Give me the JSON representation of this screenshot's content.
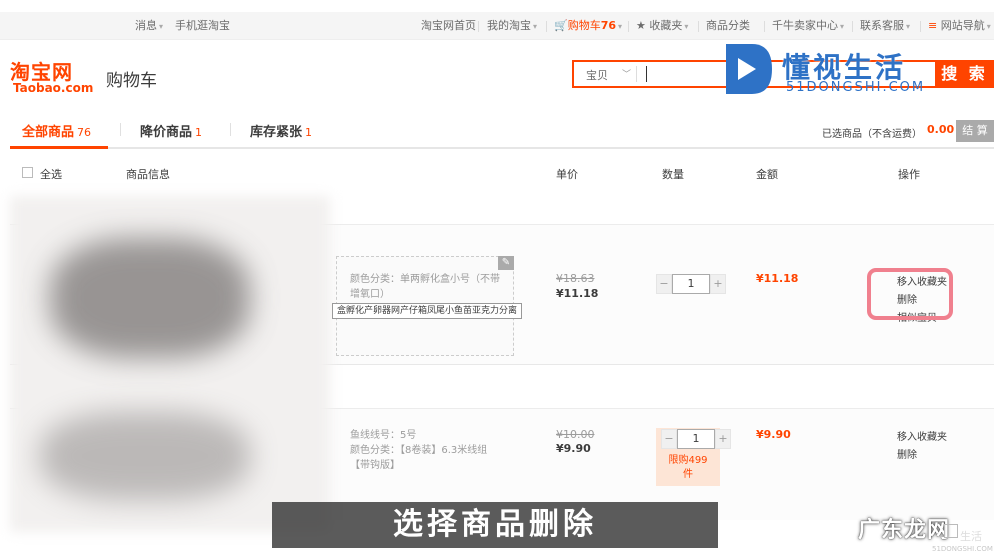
{
  "topbar": {
    "messages": "消息",
    "mobile": "手机逛淘宝",
    "home": "淘宝网首页",
    "my_taobao": "我的淘宝",
    "cart_label": "购物车",
    "cart_count": "76",
    "favorites": "收藏夹",
    "categories": "商品分类",
    "seller_center": "千牛卖家中心",
    "service": "联系客服",
    "site_nav": "网站导航"
  },
  "header": {
    "logo_cn": "淘宝网",
    "logo_en": "Taobao.com",
    "page_title": "购物车",
    "search_category": "宝贝",
    "search_button": "搜 索"
  },
  "watermark": {
    "name": "懂视生活",
    "domain": "51DONGSHI.COM"
  },
  "tabs": [
    {
      "label": "全部商品",
      "count": "76"
    },
    {
      "label": "降价商品",
      "count": "1"
    },
    {
      "label": "库存紧张",
      "count": "1"
    }
  ],
  "summary": {
    "selected_label": "已选商品（不含运费）",
    "selected_amount": "0.00",
    "settle_button": "结 算"
  },
  "columns": {
    "select_all": "全选",
    "item_info": "商品信息",
    "unit_price": "单价",
    "quantity": "数量",
    "amount": "金额",
    "operation": "操作"
  },
  "items": [
    {
      "sku_line1": "颜色分类：单两孵化盒小号（不带",
      "sku_line2": "增氧口）",
      "tooltip": "盒孵化产卵器网产仔箱凤尾小鱼苗亚克力分离",
      "old_price": "¥18.63",
      "price": "¥11.18",
      "quantity": "1",
      "amount": "¥11.18",
      "op_favorite": "移入收藏夹",
      "op_delete": "删除",
      "op_similar": "相似宝贝"
    },
    {
      "sku_line1": "鱼线线号：5号",
      "sku_line2": "颜色分类：【8卷装】6.3米线组",
      "sku_line3": "【带钩版】",
      "old_price": "¥10.00",
      "price": "¥9.90",
      "quantity": "1",
      "limit_line1": "限购499",
      "limit_line2": "件",
      "amount": "¥9.90",
      "op_favorite": "移入收藏夹",
      "op_delete": "删除"
    }
  ],
  "subtitle": "选择商品删除",
  "watermark2": {
    "name": "广东龙网",
    "char": "生活",
    "domain": "51DONGSHI.COM"
  },
  "colors": {
    "brand": "#ff4400",
    "watermark_blue": "#2e72c6",
    "highlight": "#f0808e"
  }
}
